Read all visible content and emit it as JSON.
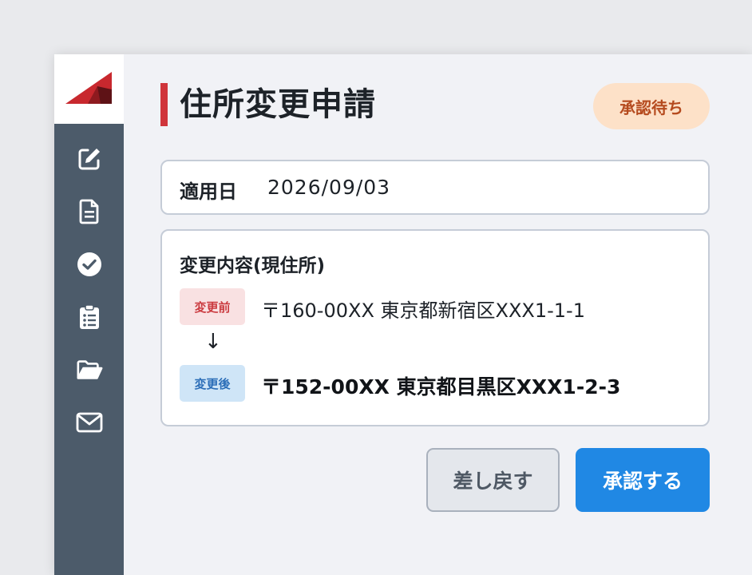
{
  "sidebar": {
    "icons": [
      {
        "name": "edit-icon"
      },
      {
        "name": "document-icon"
      },
      {
        "name": "check-circle-icon"
      },
      {
        "name": "clipboard-list-icon"
      },
      {
        "name": "folder-open-icon"
      },
      {
        "name": "mail-icon"
      }
    ]
  },
  "header": {
    "title": "住所変更申請",
    "status": "承認待ち"
  },
  "effective_date": {
    "label": "適用日",
    "value": "2026/09/03"
  },
  "change": {
    "heading": "変更内容(現住所)",
    "before_tag": "変更前",
    "before_address": "〒160-00XX 東京都新宿区XXX1-1-1",
    "arrow": "↓",
    "after_tag": "変更後",
    "after_address": "〒152-00XX 東京都目黒区XXX1-2-3"
  },
  "actions": {
    "return_label": "差し戻す",
    "approve_label": "承認する"
  },
  "colors": {
    "accent": "#d0353b",
    "primary_button": "#2088e4",
    "sidebar": "#4c5b6a",
    "status_bg": "#fde1c8",
    "status_text": "#b54a1e"
  }
}
